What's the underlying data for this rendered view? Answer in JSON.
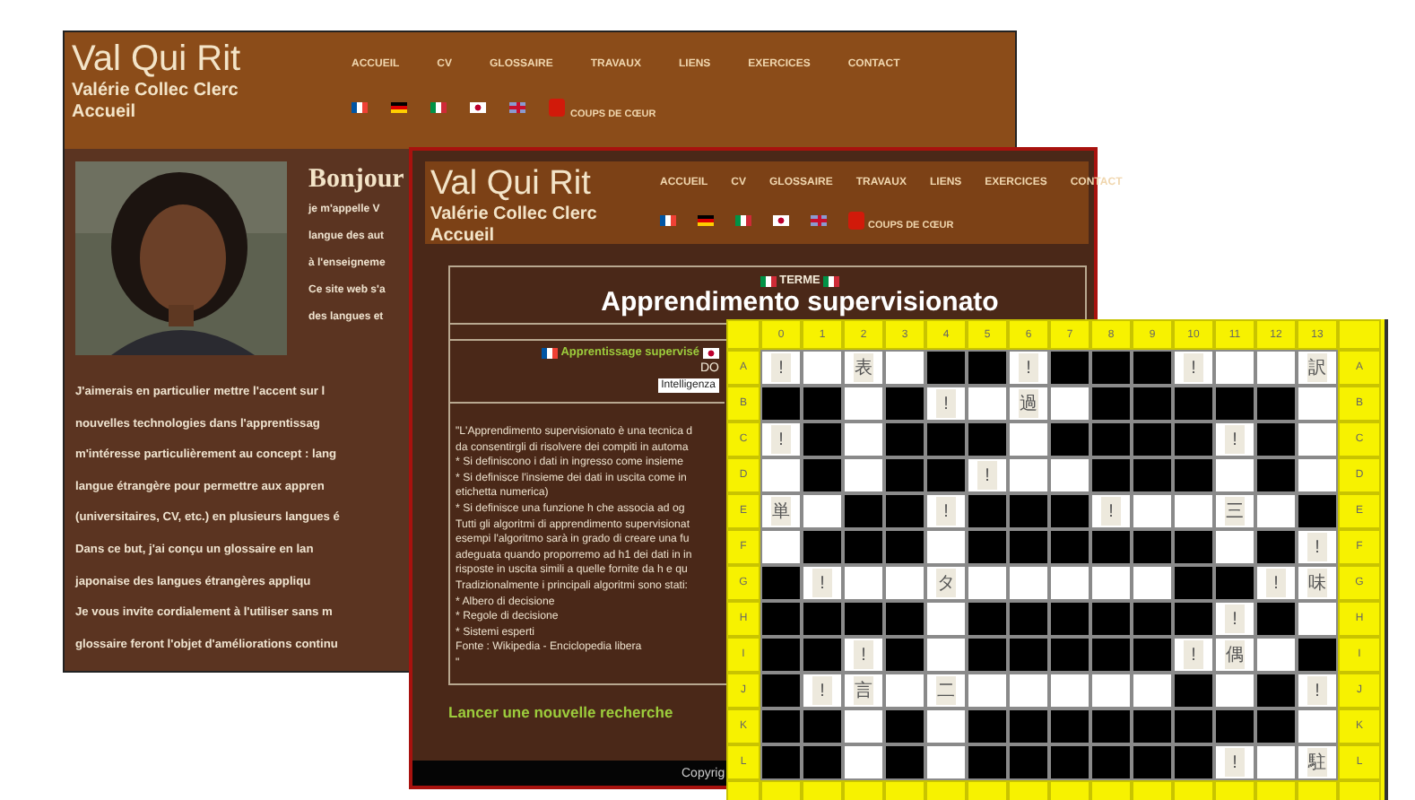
{
  "home_page": {
    "header": {
      "site_title": "Val Qui Rit",
      "author": "Valérie Collec Clerc",
      "page": "Accueil",
      "nav": [
        "ACCUEIL",
        "CV",
        "GLOSSAIRE",
        "TRAVAUX",
        "LIENS",
        "EXERCICES",
        "CONTACT"
      ],
      "favorites": "COUPS DE CŒUR"
    },
    "greeting": "Bonjour",
    "intro_lines": [
      "je m'appelle V",
      "langue des aut",
      "à l'enseigneme",
      "Ce site web s'a",
      "des langues et"
    ],
    "paragraph_lines": [
      "J'aimerais en particulier mettre l'accent sur l",
      "nouvelles technologies dans l'apprentissag",
      "m'intéresse particulièrement au concept : lang",
      "langue étrangère pour permettre aux appren",
      "(universitaires, CV, etc.) en plusieurs langues é",
      "Dans ce but, j'ai conçu un glossaire en lan",
      "japonaise des langues étrangères appliqu",
      "Je vous invite cordialement à l'utiliser sans m",
      "glossaire feront l'objet d'améliorations continu"
    ]
  },
  "glossary_page": {
    "header": {
      "site_title": "Val Qui Rit",
      "author": "Valérie Collec Clerc",
      "page": "Accueil",
      "nav": [
        "ACCUEIL",
        "CV",
        "GLOSSAIRE",
        "TRAVAUX",
        "LIENS",
        "EXERCICES",
        "CONTACT"
      ],
      "favorites": "COUPS DE CŒUR"
    },
    "term_label": "TERME",
    "term": "Apprendimento supervisionato",
    "translation": "Apprentissage supervisé",
    "domain_label": "DO",
    "domain_value": "Intelligenza",
    "definition_lines": [
      "\"L'Apprendimento supervisionato è una tecnica d",
      "da consentirgli di risolvere dei compiti in automa",
      "* Si definiscono i dati in ingresso come insieme",
      "* Si definisce l'insieme dei dati in uscita come in",
      "etichetta numerica)",
      "* Si definisce una funzione h che associa ad og",
      "Tutti gli algoritmi di apprendimento supervisionat",
      "esempi l'algoritmo sarà in grado di creare una fu",
      "adeguata quando proporremo ad h1 dei dati in in",
      "risposte in uscita simili a quelle fornite da h e qu",
      "Tradizionalmente i principali algoritmi sono stati:",
      "* Albero di decisione",
      "* Regole di decisione",
      "* Sistemi esperti",
      "Fonte : Wikipedia - Enciclopedia libera",
      "\""
    ],
    "search_link": "Lancer une nouvelle recherche",
    "footer": "Copyrig"
  },
  "crossword": {
    "columns": [
      "0",
      "1",
      "2",
      "3",
      "4",
      "5",
      "6",
      "7",
      "8",
      "9",
      "10",
      "11",
      "12",
      "13"
    ],
    "rows": [
      {
        "left": "A",
        "right": "A",
        "cells": [
          {
            "kind": "glyph",
            "text": "!"
          },
          {
            "kind": "open"
          },
          {
            "kind": "glyph",
            "text": "表"
          },
          {
            "kind": "open"
          },
          {
            "kind": "block"
          },
          {
            "kind": "block"
          },
          {
            "kind": "glyph",
            "text": "!"
          },
          {
            "kind": "block"
          },
          {
            "kind": "block"
          },
          {
            "kind": "block"
          },
          {
            "kind": "glyph",
            "text": "!"
          },
          {
            "kind": "open"
          },
          {
            "kind": "open"
          },
          {
            "kind": "glyph",
            "text": "訳"
          }
        ]
      },
      {
        "left": "B",
        "right": "B",
        "cells": [
          {
            "kind": "block"
          },
          {
            "kind": "block"
          },
          {
            "kind": "open"
          },
          {
            "kind": "block"
          },
          {
            "kind": "glyph",
            "text": "!"
          },
          {
            "kind": "open"
          },
          {
            "kind": "glyph",
            "text": "過"
          },
          {
            "kind": "open"
          },
          {
            "kind": "block"
          },
          {
            "kind": "block"
          },
          {
            "kind": "block"
          },
          {
            "kind": "block"
          },
          {
            "kind": "block"
          },
          {
            "kind": "open"
          }
        ]
      },
      {
        "left": "C",
        "right": "C",
        "cells": [
          {
            "kind": "glyph",
            "text": "!"
          },
          {
            "kind": "block"
          },
          {
            "kind": "open"
          },
          {
            "kind": "block"
          },
          {
            "kind": "block"
          },
          {
            "kind": "block"
          },
          {
            "kind": "open"
          },
          {
            "kind": "block"
          },
          {
            "kind": "block"
          },
          {
            "kind": "block"
          },
          {
            "kind": "block"
          },
          {
            "kind": "glyph",
            "text": "!"
          },
          {
            "kind": "block"
          },
          {
            "kind": "open"
          }
        ]
      },
      {
        "left": "D",
        "right": "D",
        "cells": [
          {
            "kind": "open"
          },
          {
            "kind": "block"
          },
          {
            "kind": "open"
          },
          {
            "kind": "block"
          },
          {
            "kind": "block"
          },
          {
            "kind": "glyph",
            "text": "!"
          },
          {
            "kind": "open"
          },
          {
            "kind": "open"
          },
          {
            "kind": "block"
          },
          {
            "kind": "block"
          },
          {
            "kind": "block"
          },
          {
            "kind": "open"
          },
          {
            "kind": "block"
          },
          {
            "kind": "open"
          }
        ]
      },
      {
        "left": "E",
        "right": "E",
        "cells": [
          {
            "kind": "glyph",
            "text": "単"
          },
          {
            "kind": "open"
          },
          {
            "kind": "block"
          },
          {
            "kind": "block"
          },
          {
            "kind": "glyph",
            "text": "!"
          },
          {
            "kind": "block"
          },
          {
            "kind": "block"
          },
          {
            "kind": "block"
          },
          {
            "kind": "glyph",
            "text": "!"
          },
          {
            "kind": "open"
          },
          {
            "kind": "open"
          },
          {
            "kind": "glyph",
            "text": "三"
          },
          {
            "kind": "open"
          },
          {
            "kind": "block"
          }
        ]
      },
      {
        "left": "F",
        "right": "F",
        "cells": [
          {
            "kind": "open"
          },
          {
            "kind": "block"
          },
          {
            "kind": "block"
          },
          {
            "kind": "block"
          },
          {
            "kind": "open"
          },
          {
            "kind": "block"
          },
          {
            "kind": "block"
          },
          {
            "kind": "block"
          },
          {
            "kind": "block"
          },
          {
            "kind": "block"
          },
          {
            "kind": "block"
          },
          {
            "kind": "open"
          },
          {
            "kind": "block"
          },
          {
            "kind": "glyph",
            "text": "!"
          }
        ]
      },
      {
        "left": "G",
        "right": "G",
        "cells": [
          {
            "kind": "block"
          },
          {
            "kind": "glyph",
            "text": "!"
          },
          {
            "kind": "open"
          },
          {
            "kind": "open"
          },
          {
            "kind": "glyph",
            "text": "タ"
          },
          {
            "kind": "open"
          },
          {
            "kind": "open"
          },
          {
            "kind": "open"
          },
          {
            "kind": "open"
          },
          {
            "kind": "open"
          },
          {
            "kind": "block"
          },
          {
            "kind": "block"
          },
          {
            "kind": "glyph",
            "text": "!"
          },
          {
            "kind": "glyph",
            "text": "味"
          }
        ]
      },
      {
        "left": "H",
        "right": "H",
        "cells": [
          {
            "kind": "block"
          },
          {
            "kind": "block"
          },
          {
            "kind": "block"
          },
          {
            "kind": "block"
          },
          {
            "kind": "open"
          },
          {
            "kind": "block"
          },
          {
            "kind": "block"
          },
          {
            "kind": "block"
          },
          {
            "kind": "block"
          },
          {
            "kind": "block"
          },
          {
            "kind": "block"
          },
          {
            "kind": "glyph",
            "text": "!"
          },
          {
            "kind": "block"
          },
          {
            "kind": "open"
          }
        ]
      },
      {
        "left": "I",
        "right": "I",
        "cells": [
          {
            "kind": "block"
          },
          {
            "kind": "block"
          },
          {
            "kind": "glyph",
            "text": "!"
          },
          {
            "kind": "block"
          },
          {
            "kind": "open"
          },
          {
            "kind": "block"
          },
          {
            "kind": "block"
          },
          {
            "kind": "block"
          },
          {
            "kind": "block"
          },
          {
            "kind": "block"
          },
          {
            "kind": "glyph",
            "text": "!"
          },
          {
            "kind": "glyph",
            "text": "偶"
          },
          {
            "kind": "open"
          },
          {
            "kind": "block"
          }
        ]
      },
      {
        "left": "J",
        "right": "J",
        "cells": [
          {
            "kind": "block"
          },
          {
            "kind": "glyph",
            "text": "!"
          },
          {
            "kind": "glyph",
            "text": "言"
          },
          {
            "kind": "open"
          },
          {
            "kind": "glyph",
            "text": "二"
          },
          {
            "kind": "open"
          },
          {
            "kind": "open"
          },
          {
            "kind": "open"
          },
          {
            "kind": "open"
          },
          {
            "kind": "open"
          },
          {
            "kind": "block"
          },
          {
            "kind": "open"
          },
          {
            "kind": "block"
          },
          {
            "kind": "glyph",
            "text": "!"
          }
        ]
      },
      {
        "left": "K",
        "right": "K",
        "cells": [
          {
            "kind": "block"
          },
          {
            "kind": "block"
          },
          {
            "kind": "open"
          },
          {
            "kind": "block"
          },
          {
            "kind": "open"
          },
          {
            "kind": "block"
          },
          {
            "kind": "block"
          },
          {
            "kind": "block"
          },
          {
            "kind": "block"
          },
          {
            "kind": "block"
          },
          {
            "kind": "block"
          },
          {
            "kind": "block"
          },
          {
            "kind": "block"
          },
          {
            "kind": "open"
          }
        ]
      },
      {
        "left": "L",
        "right": "L",
        "cells": [
          {
            "kind": "block"
          },
          {
            "kind": "block"
          },
          {
            "kind": "open"
          },
          {
            "kind": "block"
          },
          {
            "kind": "open"
          },
          {
            "kind": "block"
          },
          {
            "kind": "block"
          },
          {
            "kind": "block"
          },
          {
            "kind": "block"
          },
          {
            "kind": "block"
          },
          {
            "kind": "block"
          },
          {
            "kind": "glyph",
            "text": "!"
          },
          {
            "kind": "open"
          },
          {
            "kind": "glyph",
            "text": "駐"
          }
        ]
      }
    ]
  }
}
